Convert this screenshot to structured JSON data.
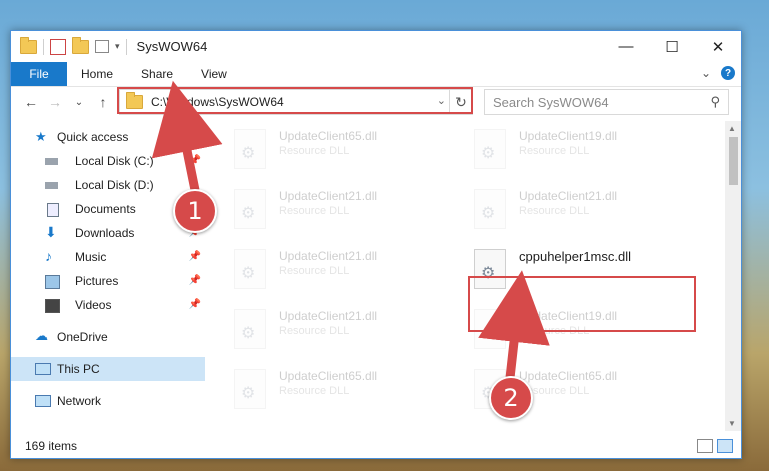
{
  "window": {
    "title": "SysWOW64"
  },
  "titlebar": {
    "minimize": "—",
    "maximize": "☐",
    "close": "✕"
  },
  "ribbon": {
    "tabs": [
      "File",
      "Home",
      "Share",
      "View"
    ],
    "expand": "⌄"
  },
  "nav": {
    "back": "←",
    "forward": "→",
    "recent": "⌄",
    "up": "↑",
    "address": "C:\\Windows\\SysWOW64",
    "search_placeholder": "Search SysWOW64"
  },
  "sidebar": {
    "items": [
      {
        "label": "Quick access"
      },
      {
        "label": "Local Disk (C:)"
      },
      {
        "label": "Local Disk (D:)"
      },
      {
        "label": "Documents"
      },
      {
        "label": "Downloads"
      },
      {
        "label": "Music"
      },
      {
        "label": "Pictures"
      },
      {
        "label": "Videos"
      },
      {
        "label": "OneDrive"
      },
      {
        "label": "This PC"
      },
      {
        "label": "Network"
      }
    ]
  },
  "files": {
    "left": [
      {
        "name": "UpdateClient65.dll",
        "type": "Resource DLL"
      },
      {
        "name": "UpdateClient21.dll",
        "type": "Resource DLL"
      },
      {
        "name": "UpdateClient21.dll",
        "type": "Resource DLL"
      },
      {
        "name": "UpdateClient21.dll",
        "type": "Resource DLL"
      },
      {
        "name": "UpdateClient65.dll",
        "type": "Resource DLL"
      }
    ],
    "right": [
      {
        "name": "UpdateClient19.dll",
        "type": "Resource DLL"
      },
      {
        "name": "UpdateClient21.dll",
        "type": "Resource DLL"
      },
      {
        "name": "cppuhelper1msc.dll",
        "type": ""
      },
      {
        "name": "UpdateClient19.dll",
        "type": "Resource DLL"
      },
      {
        "name": "UpdateClient65.dll",
        "type": "Resource DLL"
      }
    ]
  },
  "status": {
    "count": "169 items"
  },
  "annotations": {
    "step1": "1",
    "step2": "2",
    "color": "#d64a4a"
  }
}
